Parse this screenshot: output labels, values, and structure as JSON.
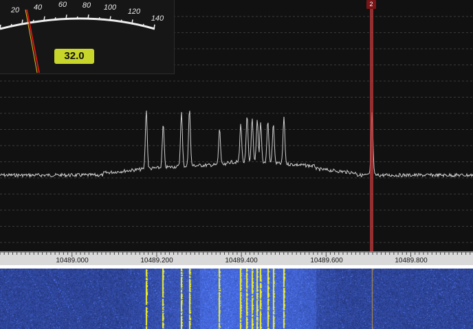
{
  "colors": {
    "background": "#111111",
    "trace": "#d0d0d0",
    "marker": "#c0393b",
    "marker_tag_bg": "#7a1416",
    "meter_value_bg": "#c8d52a",
    "waterfall_signal": "#f3f32a",
    "waterfall_noise": "#1e3a9a"
  },
  "meter": {
    "value": "32.0",
    "scale_labels": [
      "20",
      "40",
      "60",
      "80",
      "100",
      "120",
      "140"
    ],
    "needle_value": 32,
    "scale_max": 140
  },
  "marker": {
    "label": "2"
  },
  "axis": {
    "labels": [
      "10489.000",
      "10489.200",
      "10489.400",
      "10489.600",
      "10489.800"
    ]
  },
  "chart_data": {
    "type": "line",
    "x_range_mhz": [
      10488.825,
      10488.935
    ],
    "note": "",
    "signals": [
      10489.175,
      10489.215,
      10489.258,
      10489.277,
      10489.348,
      10489.398,
      10489.413,
      10489.425,
      10489.437,
      10489.445,
      10489.462,
      10489.475,
      10489.5,
      10489.708
    ]
  }
}
